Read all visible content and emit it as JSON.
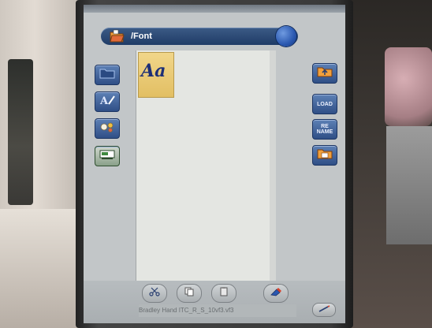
{
  "path_bar": {
    "label": "/Font",
    "icon": "folder-open-icon"
  },
  "file_list": {
    "items": [
      {
        "glyph": "Aa",
        "icon": "font-file-icon",
        "selected": true
      }
    ]
  },
  "left_buttons": [
    {
      "icon": "folder-icon"
    },
    {
      "icon": "font-edit-icon"
    },
    {
      "icon": "embroidery-pattern-icon"
    },
    {
      "icon": "sewing-machine-icon"
    }
  ],
  "right_buttons": [
    {
      "icon": "folder-up-icon",
      "label": ""
    },
    {
      "icon": "load-icon",
      "label": "LOAD"
    },
    {
      "icon": "rename-icon",
      "label": "RE NAME"
    },
    {
      "icon": "new-folder-icon",
      "label": ""
    }
  ],
  "toolbar": {
    "buttons": [
      {
        "icon": "cut-icon"
      },
      {
        "icon": "copy-icon"
      },
      {
        "icon": "paste-icon"
      },
      {
        "icon": "delete-icon"
      }
    ],
    "status": "Bradley Hand ITC_R_S_10vf3.vf3",
    "corner_icon": "pen-icon"
  },
  "colors": {
    "accent_blue": "#2f4f86",
    "selection_yellow": "#e2bf63",
    "screen_bg": "#c2c6c8"
  }
}
